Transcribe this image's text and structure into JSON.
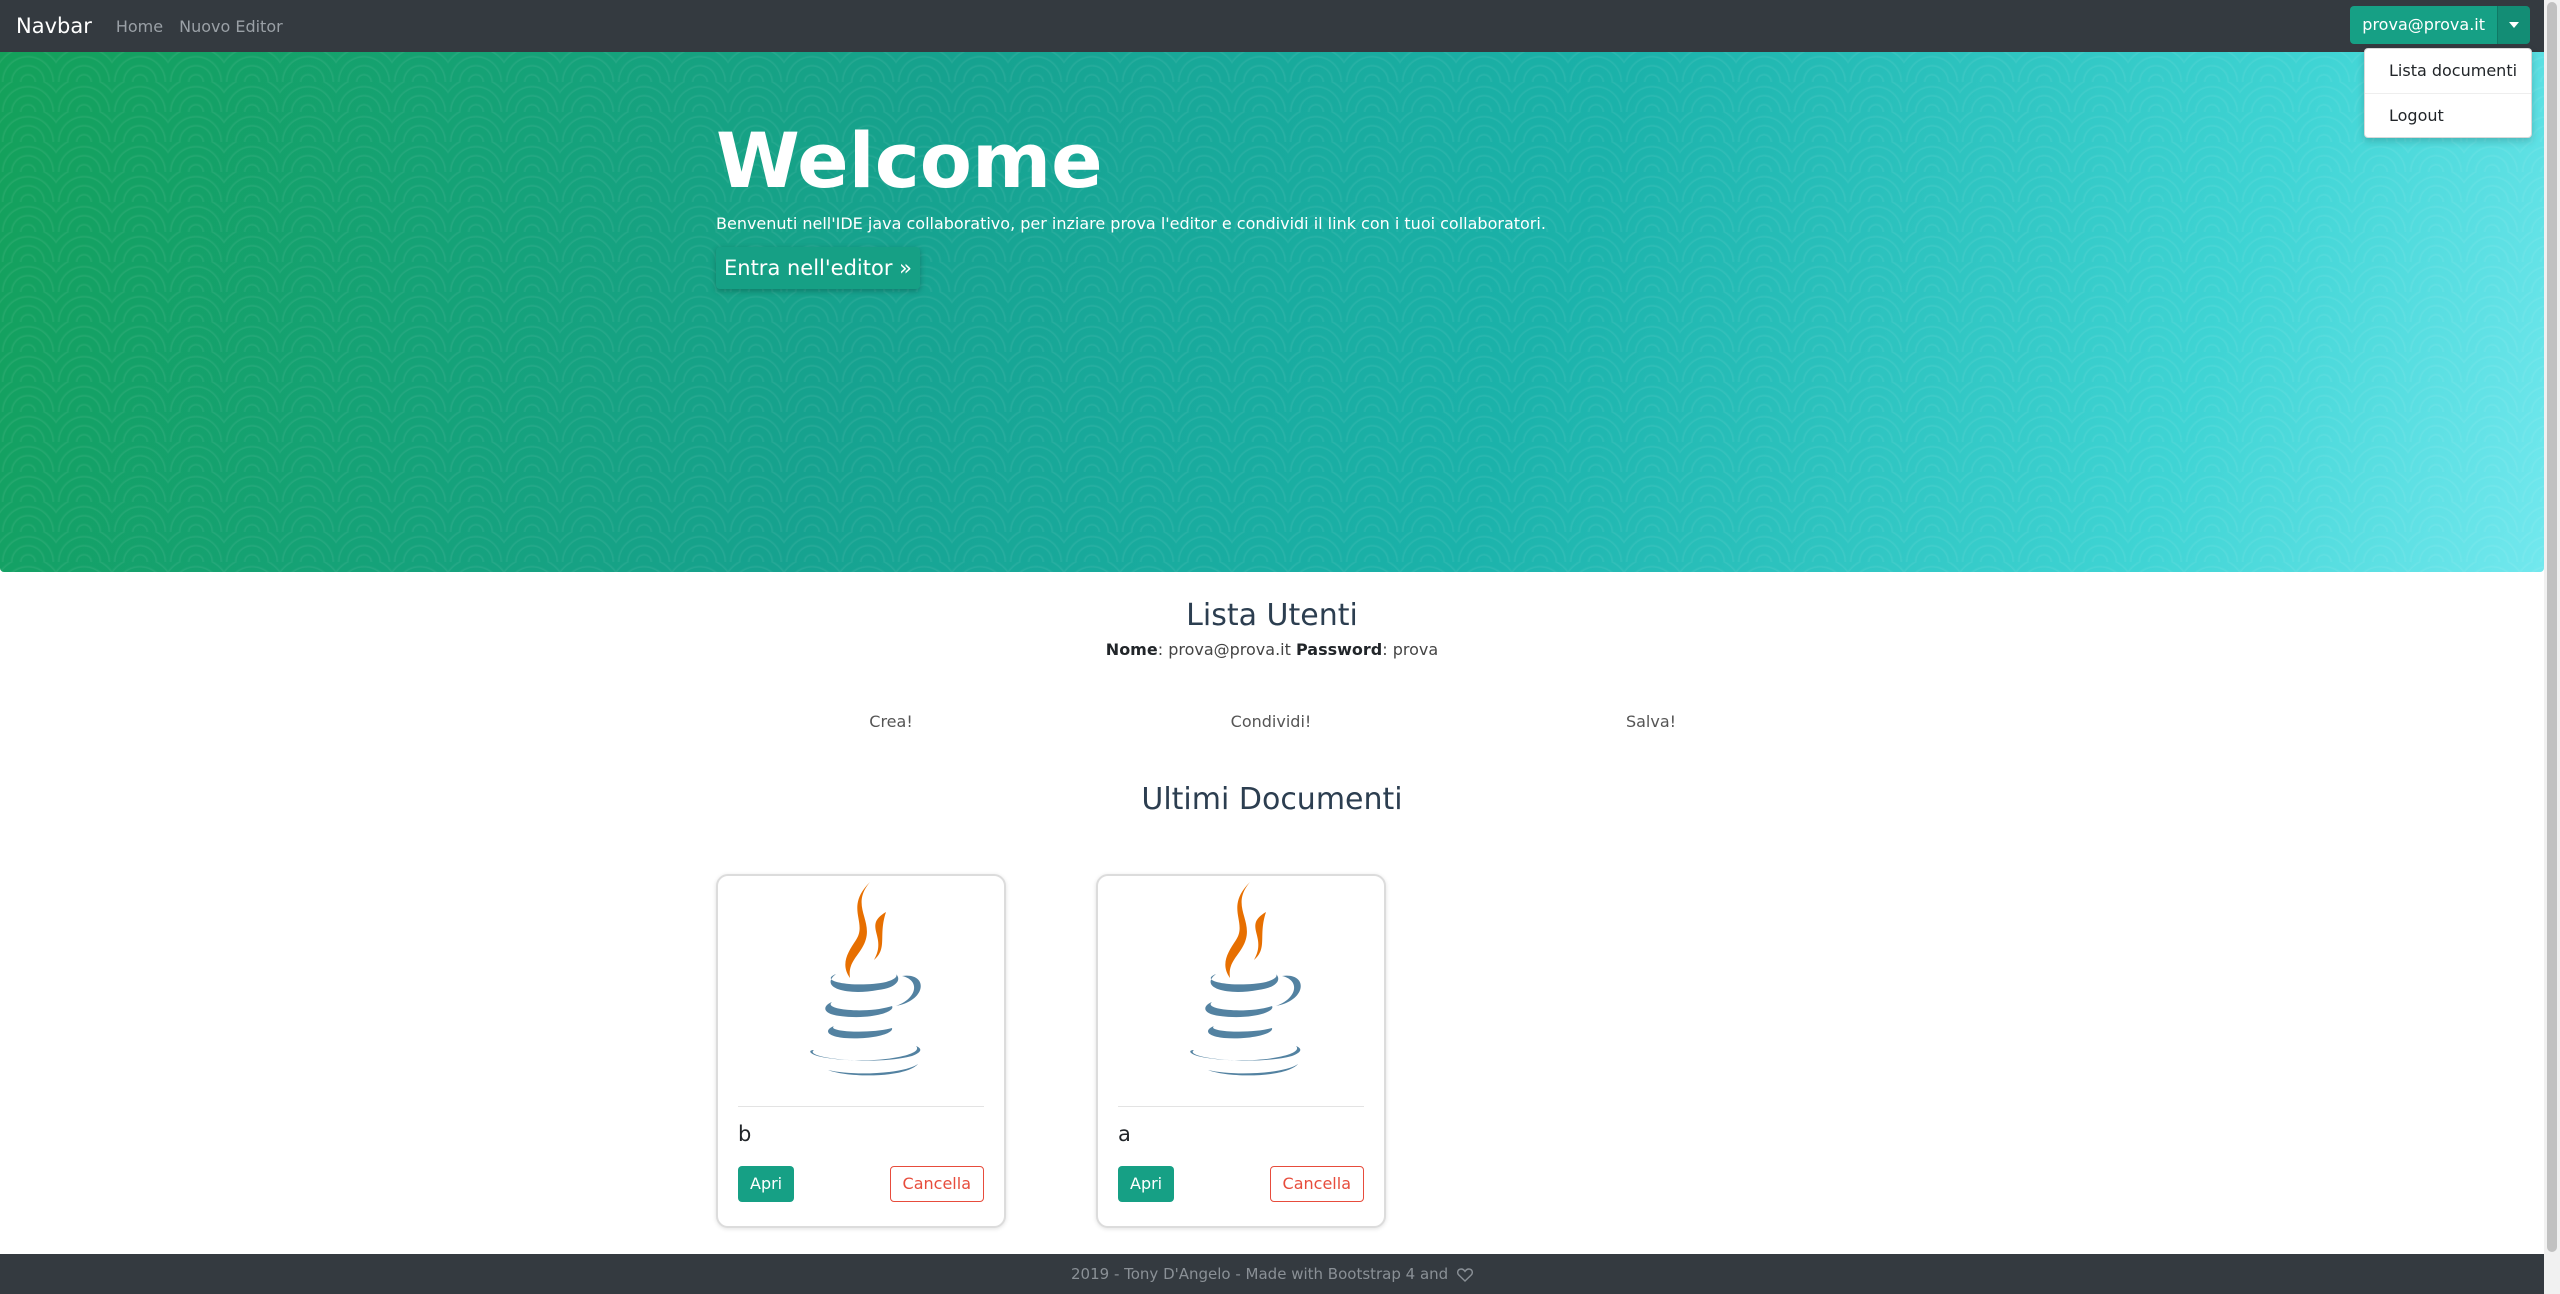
{
  "navbar": {
    "brand": "Navbar",
    "links": [
      "Home",
      "Nuovo Editor"
    ],
    "user_label": "prova@prova.it",
    "dropdown_items": [
      "Lista documenti",
      "Logout"
    ]
  },
  "hero": {
    "title": "Welcome",
    "subtitle": "Benvenuti nell'IDE java collaborativo, per inziare prova l'editor e condividi il link con i tuoi collaboratori.",
    "button_label": "Entra nell'editor »"
  },
  "users": {
    "title": "Lista Utenti",
    "name_label": "Nome",
    "name_value": "prova@prova.it",
    "password_label": "Password",
    "password_value": "prova"
  },
  "features": [
    "Crea!",
    "Condividi!",
    "Salva!"
  ],
  "documents": {
    "title": "Ultimi Documenti",
    "items": [
      {
        "name": "b",
        "open_label": "Apri",
        "delete_label": "Cancella",
        "icon": "java-logo-icon"
      },
      {
        "name": "a",
        "open_label": "Apri",
        "delete_label": "Cancella",
        "icon": "java-logo-icon"
      }
    ]
  },
  "footer": {
    "text": "2019 - Tony D'Angelo - Made with Bootstrap 4 and",
    "icon": "heart-icon"
  },
  "colors": {
    "accent": "#16a085",
    "navbar": "#343a40",
    "danger": "#e74c3c"
  }
}
